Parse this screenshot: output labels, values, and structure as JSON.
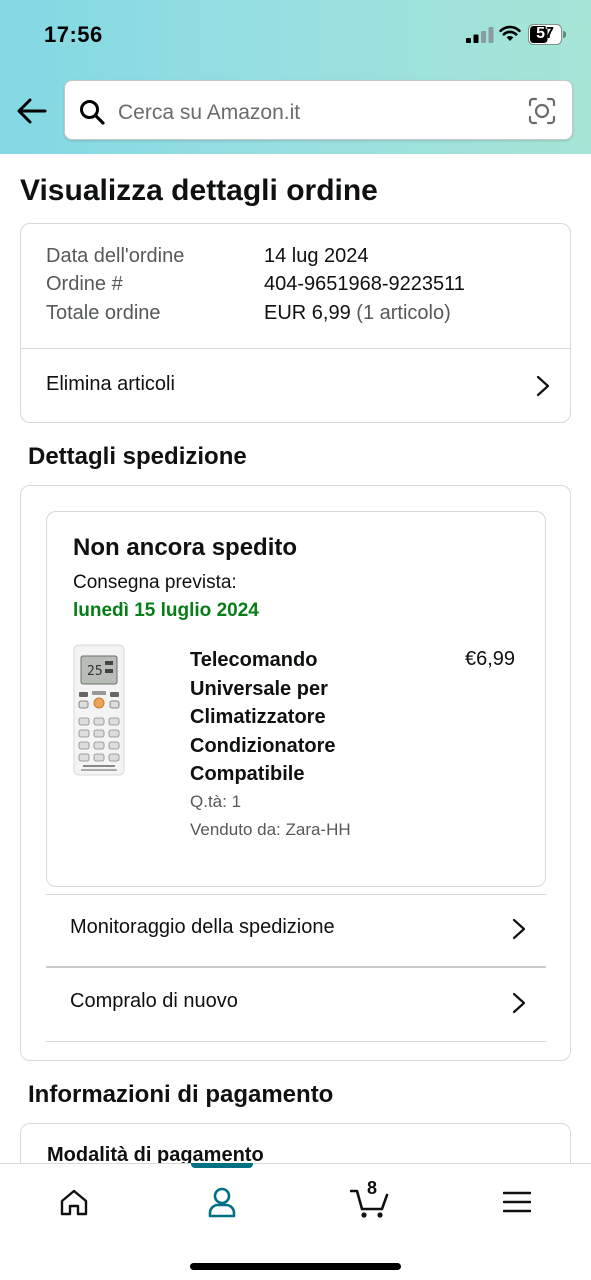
{
  "status_bar": {
    "time": "17:56",
    "battery": "57"
  },
  "search": {
    "placeholder": "Cerca su Amazon.it"
  },
  "page": {
    "title": "Visualizza dettagli ordine"
  },
  "order_summary": {
    "rows": [
      {
        "label": "Data dell'ordine",
        "value": "14 lug 2024"
      },
      {
        "label": "Ordine #",
        "value": "404-9651968-9223511"
      },
      {
        "label": "Totale ordine",
        "value": "EUR 6,99",
        "extra": "(1 articolo)"
      }
    ],
    "remove_items_label": "Elimina articoli"
  },
  "shipment": {
    "section_title": "Dettagli spedizione",
    "status": "Non ancora spedito",
    "delivery_label": "Consegna prevista:",
    "delivery_date": "lunedì 15 luglio 2024",
    "product": {
      "title_lines": [
        "Telecomando",
        "Universale per",
        "Climatizzatore",
        "Condizionatore",
        "Compatibile"
      ],
      "price": "€6,99",
      "quantity": "Q.tà: 1",
      "seller": "Venduto da: Zara-HH",
      "image_icon": "remote-control-image"
    },
    "actions": [
      {
        "label": "Monitoraggio della spedizione"
      },
      {
        "label": "Compralo di nuovo"
      }
    ]
  },
  "payment": {
    "section_title": "Informazioni di pagamento",
    "method_label": "Modalità di pagamento"
  },
  "tabbar": {
    "items": [
      "home-icon",
      "account-icon",
      "cart-icon",
      "menu-icon"
    ],
    "cart_count": "8",
    "active": "account-icon"
  },
  "colors": {
    "accent": "#007185",
    "delivery_green": "#067d16",
    "header_gradient_start": "#82d8e3",
    "header_gradient_end": "#a6e5d6"
  }
}
